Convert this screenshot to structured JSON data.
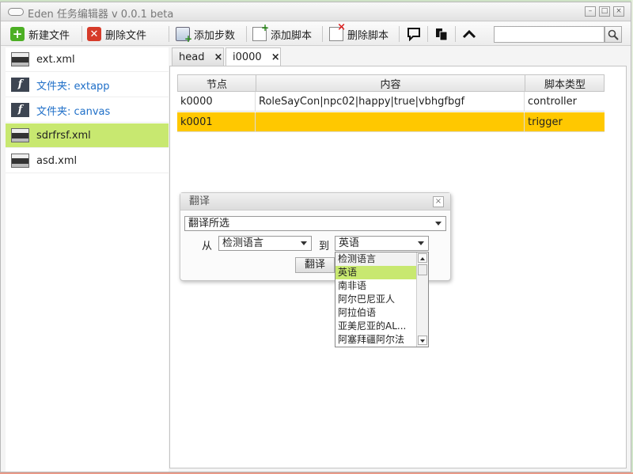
{
  "window": {
    "title": "Eden 任务编辑器 v 0.0.1 beta",
    "controls": [
      "–",
      "□",
      "×"
    ]
  },
  "toolbar": {
    "new_file": "新建文件",
    "delete_file": "删除文件",
    "add_step": "添加步数",
    "add_script": "添加脚本",
    "delete_script": "删除脚本",
    "search_placeholder": ""
  },
  "sidebar": {
    "items": [
      {
        "label": "ext.xml",
        "type": "xml"
      },
      {
        "label": "文件夹: extapp",
        "type": "folder"
      },
      {
        "label": "文件夹: canvas",
        "type": "folder"
      },
      {
        "label": "sdrfrsf.xml",
        "type": "xml",
        "selected": true
      },
      {
        "label": "asd.xml",
        "type": "xml"
      }
    ]
  },
  "tabs": [
    {
      "label": "head",
      "close": "×"
    },
    {
      "label": "i0000",
      "close": "×",
      "active": true
    }
  ],
  "grid": {
    "headers": [
      "节点",
      "内容",
      "脚本类型"
    ],
    "rows": [
      [
        "k0000",
        "RoleSayCon|npc02|happy|true|vbhgfbgf",
        "controller"
      ],
      [
        "k0001",
        "",
        "trigger"
      ]
    ],
    "selected_row": 1
  },
  "translate_dialog": {
    "title": "翻译",
    "close": "×",
    "mode": "翻译所选",
    "from_label": "从",
    "from_value": "检测语言",
    "to_label": "到",
    "to_value": "英语",
    "button": "翻译"
  },
  "dropdown": {
    "options": [
      "检测语言",
      "英语",
      "南非语",
      "阿尔巴尼亚人",
      "阿拉伯语",
      "亚美尼亚的AL...",
      "阿塞拜疆阿尔法"
    ],
    "selected": 1
  },
  "colors": {
    "selection_green": "#c8e870",
    "selected_row": "#ffc800",
    "folder_link": "#1f6fc8"
  }
}
